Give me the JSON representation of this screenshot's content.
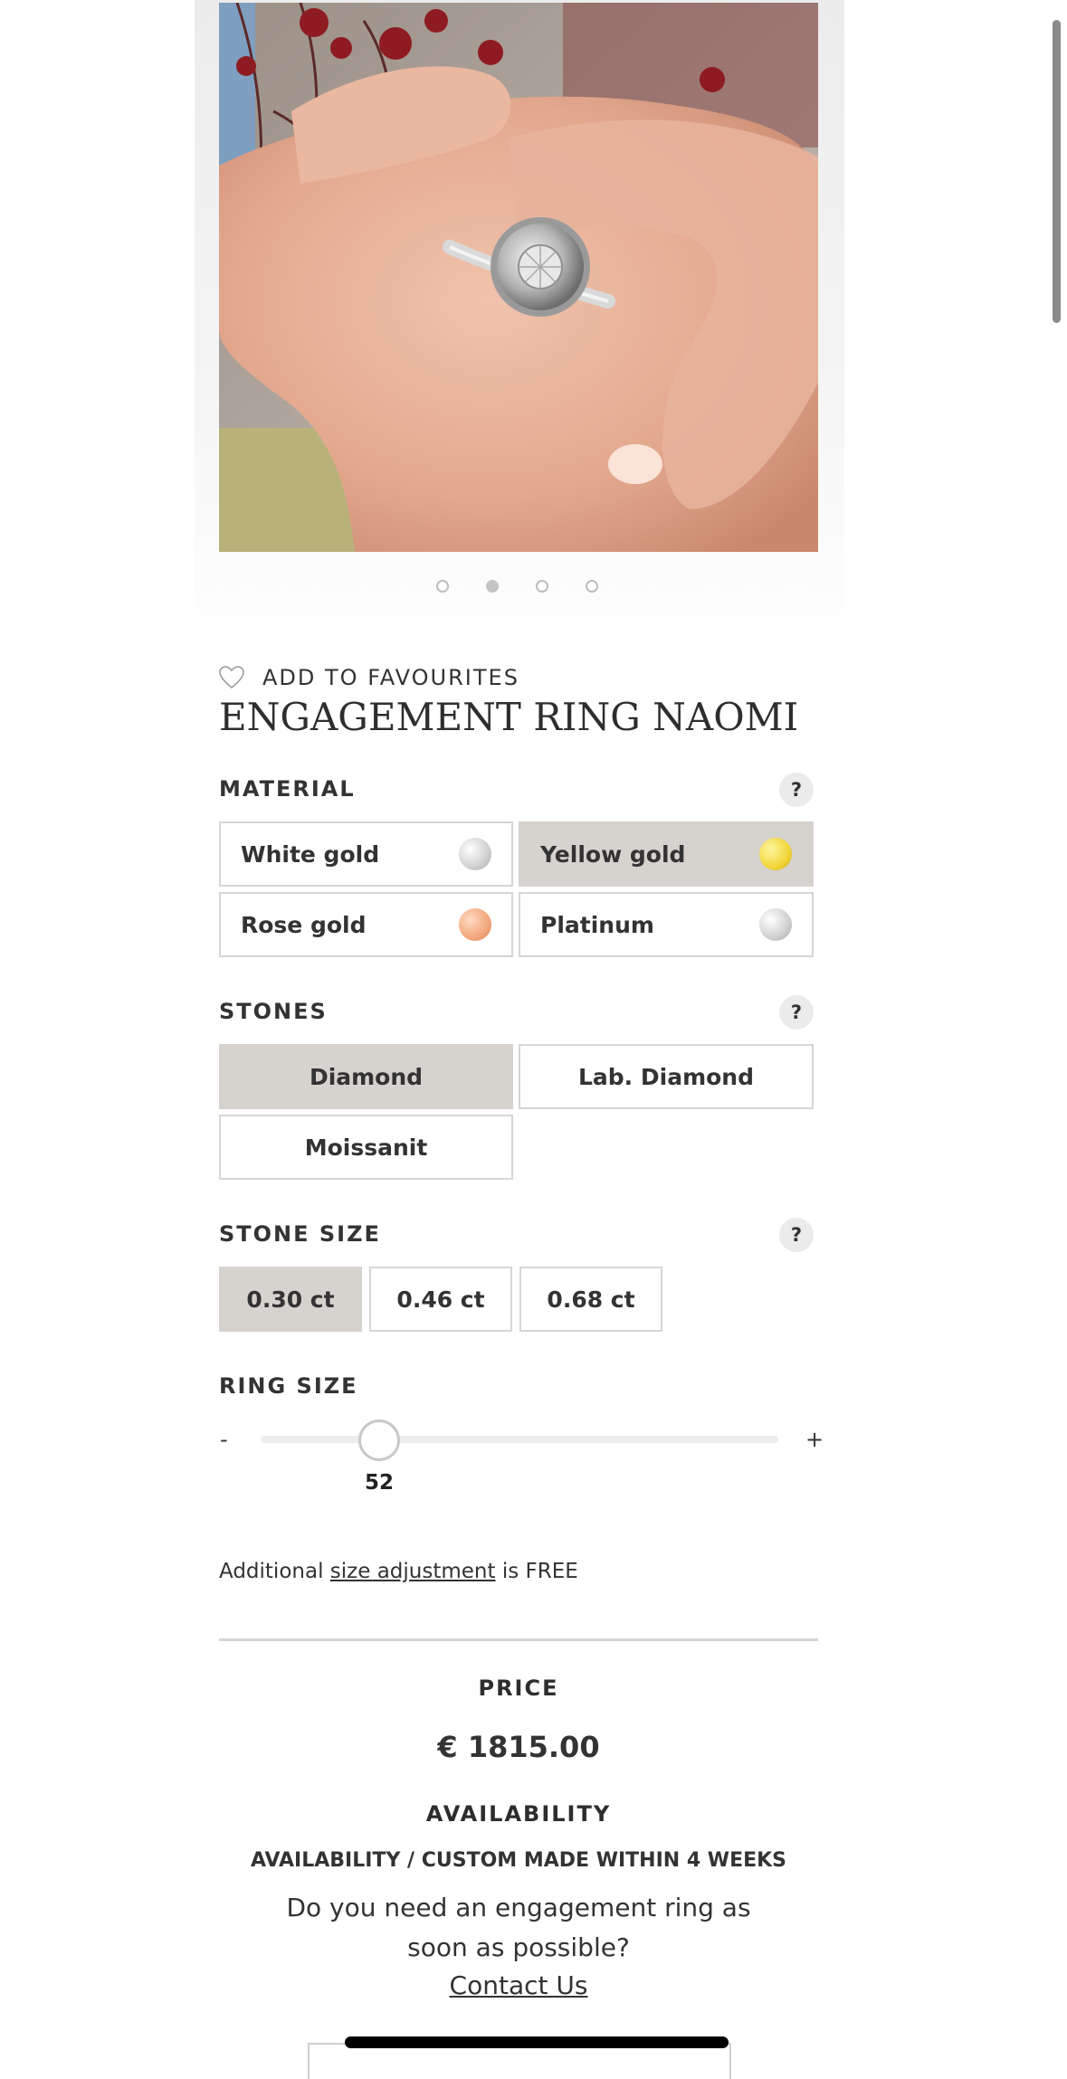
{
  "gallery": {
    "image_alt": "Engagement ring on hand",
    "dot_count": 4,
    "active_index": 1
  },
  "favourites": {
    "label": "ADD TO FAVOURITES"
  },
  "product": {
    "title": "ENGAGEMENT RING NAOMI"
  },
  "material": {
    "label": "MATERIAL",
    "help": "?",
    "options": [
      {
        "label": "White gold",
        "color": "#d9d9d9",
        "selected": false
      },
      {
        "label": "Yellow gold",
        "color": "#f2d63a",
        "selected": true
      },
      {
        "label": "Rose gold",
        "color": "#f3a77c",
        "selected": false
      },
      {
        "label": "Platinum",
        "color": "#d9d9d9",
        "selected": false
      }
    ]
  },
  "stones": {
    "label": "STONES",
    "help": "?",
    "options": [
      {
        "label": "Diamond",
        "selected": true
      },
      {
        "label": "Lab. Diamond",
        "selected": false
      },
      {
        "label": "Moissanit",
        "selected": false
      }
    ]
  },
  "stone_size": {
    "label": "STONE SIZE",
    "help": "?",
    "options": [
      {
        "label": "0.30 ct",
        "selected": true
      },
      {
        "label": "0.46 ct",
        "selected": false
      },
      {
        "label": "0.68 ct",
        "selected": false
      }
    ]
  },
  "ring_size": {
    "label": "RING SIZE",
    "minus": "-",
    "plus": "+",
    "value": "52"
  },
  "note": {
    "prefix": "Additional",
    "link": "size adjustment",
    "suffix": "is FREE"
  },
  "price": {
    "label": "PRICE",
    "value": "€ 1815.00"
  },
  "availability": {
    "label": "AVAILABILITY",
    "text": "AVAILABILITY / CUSTOM MADE WITHIN 4 WEEKS",
    "question": "Do you need an engagement ring as soon as possible?",
    "contact": "Contact Us"
  },
  "colors": {
    "selected_bg": "#d6d2ce",
    "border": "#d6d6d6",
    "text": "#2d2d2d"
  }
}
